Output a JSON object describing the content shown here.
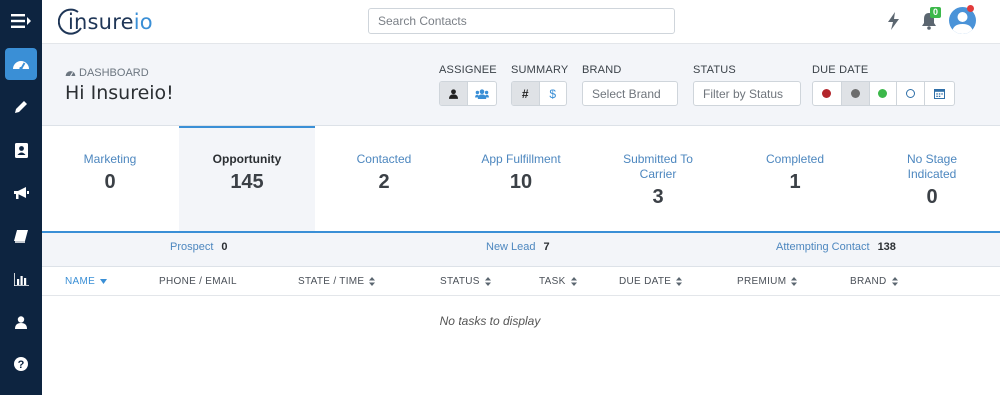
{
  "app": {
    "logo_text_a": "insure",
    "logo_text_b": "io"
  },
  "search": {
    "placeholder": "Search Contacts"
  },
  "notifications": {
    "count": "0"
  },
  "header": {
    "breadcrumb": "DASHBOARD",
    "greeting": "Hi Insureio!"
  },
  "filters": {
    "assignee_label": "ASSIGNEE",
    "summary_label": "SUMMARY",
    "summary_hash": "#",
    "summary_dollar": "$",
    "brand_label": "BRAND",
    "brand_placeholder": "Select Brand",
    "status_label": "STATUS",
    "status_placeholder": "Filter by Status",
    "due_date_label": "DUE DATE"
  },
  "stages": [
    {
      "name": "Marketing",
      "count": "0"
    },
    {
      "name": "Opportunity",
      "count": "145"
    },
    {
      "name": "Contacted",
      "count": "2"
    },
    {
      "name": "App Fulfillment",
      "count": "10"
    },
    {
      "name": "Submitted To Carrier",
      "count": "3"
    },
    {
      "name": "Completed",
      "count": "1"
    },
    {
      "name": "No Stage Indicated",
      "count": "0"
    }
  ],
  "substages": [
    {
      "name": "Prospect",
      "count": "0"
    },
    {
      "name": "New Lead",
      "count": "7"
    },
    {
      "name": "Attempting Contact",
      "count": "138"
    }
  ],
  "table": {
    "columns": [
      "NAME",
      "PHONE / EMAIL",
      "STATE / TIME",
      "STATUS",
      "TASK",
      "DUE DATE",
      "PREMIUM",
      "BRAND"
    ],
    "empty_text": "No tasks to display"
  },
  "colors": {
    "accent": "#3a8fd6",
    "sidebar": "#0d2440",
    "dot_red": "#b3262c",
    "dot_gray": "#6d6d6d",
    "dot_green": "#3cb84a"
  }
}
